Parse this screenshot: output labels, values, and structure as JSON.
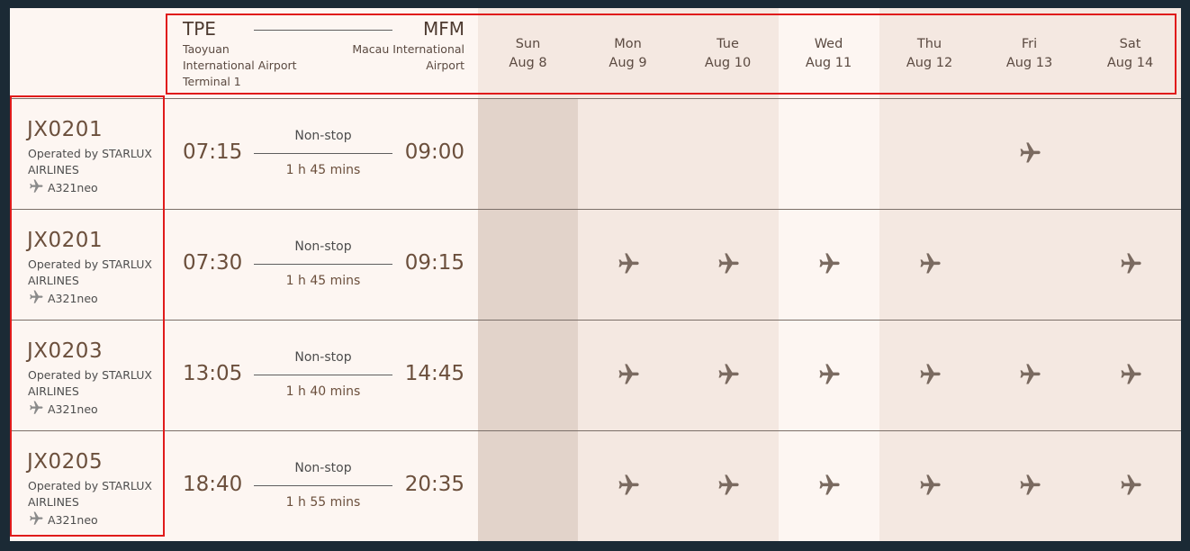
{
  "route": {
    "origin_code": "TPE",
    "origin_airport": "Taoyuan International Airport Terminal 1",
    "origin_line1": "Taoyuan",
    "origin_line2": "International Airport",
    "origin_line3": "Terminal 1",
    "dest_code": "MFM",
    "dest_line1": "Macau International",
    "dest_line2": "Airport"
  },
  "days": [
    {
      "weekday": "Sun",
      "date": "Aug 8"
    },
    {
      "weekday": "Mon",
      "date": "Aug 9"
    },
    {
      "weekday": "Tue",
      "date": "Aug 10"
    },
    {
      "weekday": "Wed",
      "date": "Aug 11"
    },
    {
      "weekday": "Thu",
      "date": "Aug 12"
    },
    {
      "weekday": "Fri",
      "date": "Aug 13"
    },
    {
      "weekday": "Sat",
      "date": "Aug 14"
    }
  ],
  "flights": [
    {
      "number": "JX0201",
      "operator": "Operated by STARLUX AIRLINES",
      "aircraft": "A321neo",
      "depart": "07:15",
      "arrive": "09:00",
      "stops": "Non-stop",
      "duration": "1 h 45 mins",
      "operates": [
        false,
        false,
        false,
        false,
        false,
        true,
        false
      ]
    },
    {
      "number": "JX0201",
      "operator": "Operated by STARLUX AIRLINES",
      "aircraft": "A321neo",
      "depart": "07:30",
      "arrive": "09:15",
      "stops": "Non-stop",
      "duration": "1 h 45 mins",
      "operates": [
        false,
        true,
        true,
        true,
        true,
        false,
        true
      ]
    },
    {
      "number": "JX0203",
      "operator": "Operated by STARLUX AIRLINES",
      "aircraft": "A321neo",
      "depart": "13:05",
      "arrive": "14:45",
      "stops": "Non-stop",
      "duration": "1 h 40 mins",
      "operates": [
        false,
        true,
        true,
        true,
        true,
        true,
        true
      ]
    },
    {
      "number": "JX0205",
      "operator": "Operated by STARLUX AIRLINES",
      "aircraft": "A321neo",
      "depart": "18:40",
      "arrive": "20:35",
      "stops": "Non-stop",
      "duration": "1 h 55 mins",
      "operates": [
        false,
        true,
        true,
        true,
        true,
        true,
        true
      ]
    }
  ],
  "icons": {
    "plane": "plane-icon"
  },
  "colors": {
    "highlight": "#e01b1b",
    "plane": "#7a6a60"
  }
}
